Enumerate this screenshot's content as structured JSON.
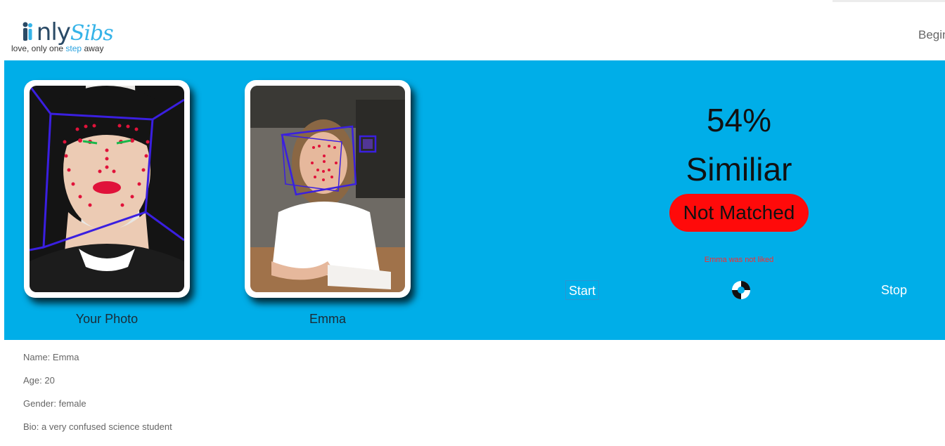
{
  "header": {
    "logo_text_main": "nly",
    "logo_text_accent": "Sibs",
    "tagline_before": "love, only one",
    "tagline_highlight": "step",
    "tagline_after": "away",
    "nav_begin": "Begin"
  },
  "match": {
    "user_photo_label": "Your Photo",
    "candidate_label": "Emma",
    "percent": "54%",
    "similar_label": "Similiar",
    "status_label": "Not Matched",
    "liked_message": "Emma was not liked",
    "start_label": "Start",
    "stop_label": "Stop"
  },
  "profile": {
    "name": "Name: Emma",
    "age": "Age: 20",
    "gender": "Gender: female",
    "bio": "Bio: a very confused science student"
  },
  "colors": {
    "brand_blue": "#00aee8",
    "status_red": "#ff0a0a",
    "landmark_red": "#e0123a",
    "box_purple": "#3a1fe0"
  }
}
